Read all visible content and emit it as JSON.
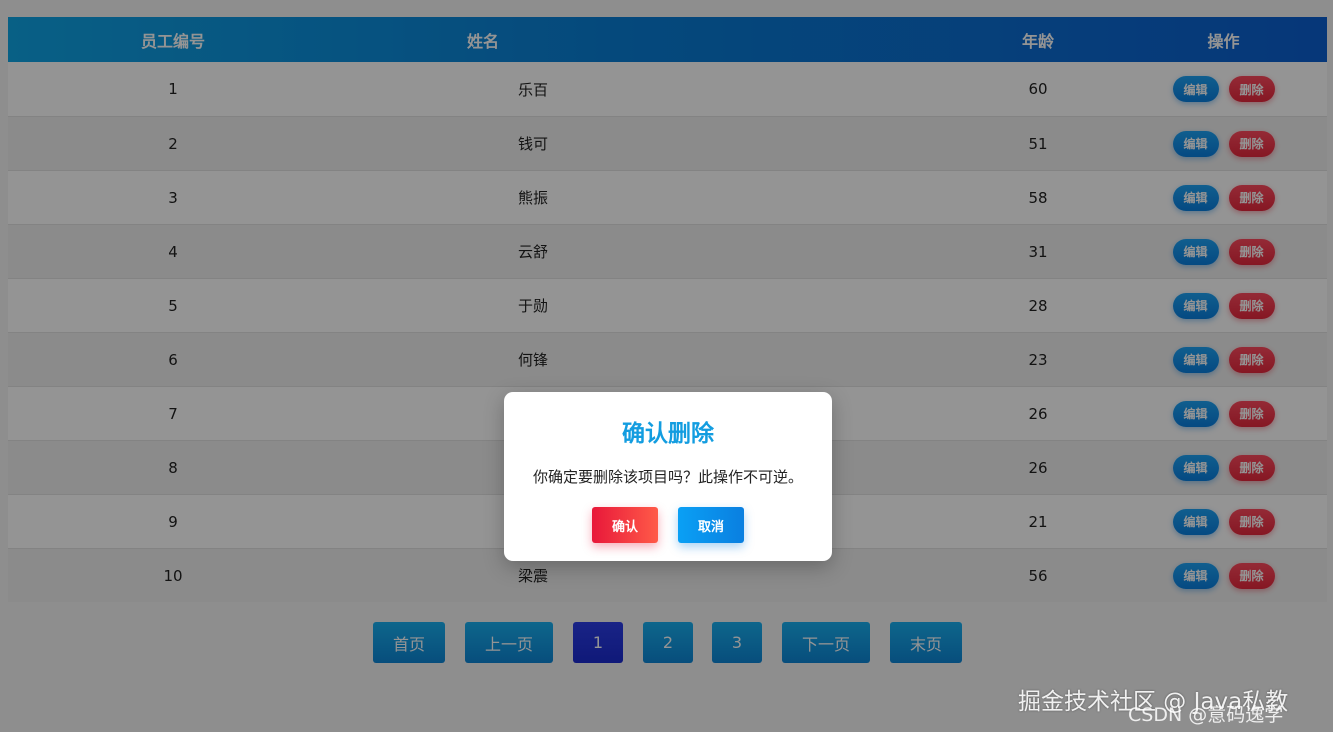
{
  "table": {
    "headers": [
      "员工编号",
      "姓名",
      "年龄",
      "操作"
    ],
    "rows": [
      {
        "id": "1",
        "name": "乐百",
        "age": "60"
      },
      {
        "id": "2",
        "name": "钱可",
        "age": "51"
      },
      {
        "id": "3",
        "name": "熊振",
        "age": "58"
      },
      {
        "id": "4",
        "name": "云舒",
        "age": "31"
      },
      {
        "id": "5",
        "name": "于勋",
        "age": "28"
      },
      {
        "id": "6",
        "name": "何锋",
        "age": "23"
      },
      {
        "id": "7",
        "name": "",
        "age": "26"
      },
      {
        "id": "8",
        "name": "",
        "age": "26"
      },
      {
        "id": "9",
        "name": "",
        "age": "21"
      },
      {
        "id": "10",
        "name": "梁震",
        "age": "56"
      }
    ],
    "edit_label": "编辑",
    "delete_label": "删除"
  },
  "pagination": {
    "first": "首页",
    "prev": "上一页",
    "pages": [
      "1",
      "2",
      "3"
    ],
    "current": "1",
    "next": "下一页",
    "last": "末页"
  },
  "dialog": {
    "title": "确认删除",
    "message": "你确定要删除该项目吗？此操作不可逆。",
    "confirm_label": "确认",
    "cancel_label": "取消"
  },
  "watermark": {
    "line1": "掘金技术社区 @ Java私教",
    "line2": "CSDN @意码逸学"
  },
  "colors": {
    "header_gradient_start": "#0fa5e6",
    "header_gradient_end": "#0b5fd0",
    "edit_button": "#0a7fe0",
    "delete_button": "#e6283d",
    "dialog_title": "#139de0",
    "active_page": "#1b2bd0"
  }
}
